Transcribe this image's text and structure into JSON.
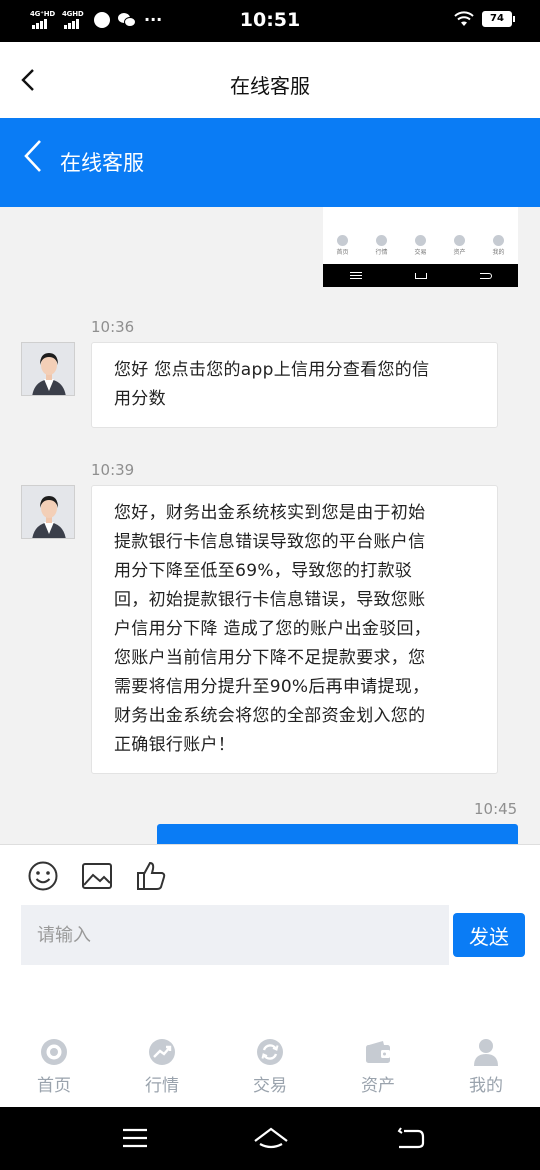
{
  "status_bar": {
    "time": "10:51",
    "signal_1": "4G⁺HD",
    "signal_2": "4GHD",
    "battery": "74"
  },
  "header": {
    "title": "在线客服"
  },
  "service_header": {
    "title": "在线客服"
  },
  "chat": {
    "shared_image": {
      "tabs": [
        "首页",
        "行情",
        "交易",
        "资产",
        "我的"
      ]
    },
    "messages": [
      {
        "time": "10:36",
        "direction": "incoming",
        "lines": [
          "您好 您点击您的app上信用分查看您的信",
          "用分数"
        ]
      },
      {
        "time": "10:39",
        "direction": "incoming",
        "lines": [
          "您好，财务出金系统核实到您是由于初始",
          "提款银行卡信息错误导致您的平台账户信",
          "用分下降至低至69%，导致您的打款驳",
          "回，初始提款银行卡信息错误，导致您账",
          "户信用分下降 造成了您的账户出金驳回，",
          "您账户当前信用分下降不足提款要求，您",
          "需要将信用分提升至90%后再申请提现，",
          "财务出金系统会将您的全部资金划入您的",
          "正确银行账户！"
        ]
      },
      {
        "time": "10:45",
        "direction": "outgoing"
      }
    ]
  },
  "composer": {
    "placeholder": "请输入",
    "send_label": "发送",
    "tools": [
      "emoji-icon",
      "image-icon",
      "thumbs-up-icon"
    ]
  },
  "tabbar": {
    "items": [
      {
        "label": "首页",
        "icon": "home-icon"
      },
      {
        "label": "行情",
        "icon": "market-icon"
      },
      {
        "label": "交易",
        "icon": "trade-icon"
      },
      {
        "label": "资产",
        "icon": "wallet-icon"
      },
      {
        "label": "我的",
        "icon": "profile-icon"
      }
    ]
  },
  "colors": {
    "primary": "#0a7cf5",
    "chat_background": "#f2f2f2",
    "tab_inactive": "#9aa3ad"
  }
}
